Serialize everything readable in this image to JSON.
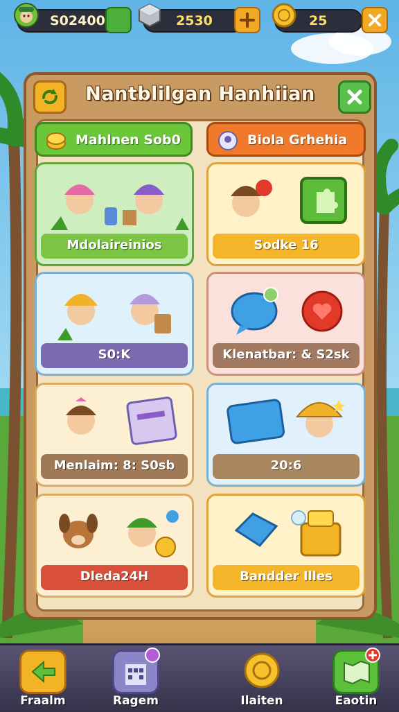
{
  "topbar": {
    "currency1": "S02400",
    "currency2": "2530",
    "currency3": "25"
  },
  "panel": {
    "title": "Nantblilgan Hanhiian"
  },
  "tabs": [
    {
      "label": "Mahlnen Sob0",
      "color": "#6cc63a"
    },
    {
      "label": "Biola Grhehia",
      "color": "#f07a2a"
    }
  ],
  "cards": [
    {
      "label": "Mdolaireinios",
      "bar_color": "#7cc443"
    },
    {
      "label": "Sodke 16",
      "bar_color": "#f5b52a"
    },
    {
      "label": "S0:K",
      "bar_color": "#7a6bb0"
    },
    {
      "label": "Klenatbar: & S2sk",
      "bar_color": "#a27a62"
    },
    {
      "label": "Menlaim: 8: S0sb",
      "bar_color": "#a07a58"
    },
    {
      "label": "20:6",
      "bar_color": "#a8865e"
    },
    {
      "label": "Dleda24H",
      "bar_color": "#d9503a"
    },
    {
      "label": "Bandder Illes",
      "bar_color": "#f5b52a"
    }
  ],
  "bottom_nav": [
    {
      "label": "Fraalm"
    },
    {
      "label": "Ragem"
    },
    {
      "label": "Ilaiten"
    },
    {
      "label": "Eaotin"
    }
  ]
}
